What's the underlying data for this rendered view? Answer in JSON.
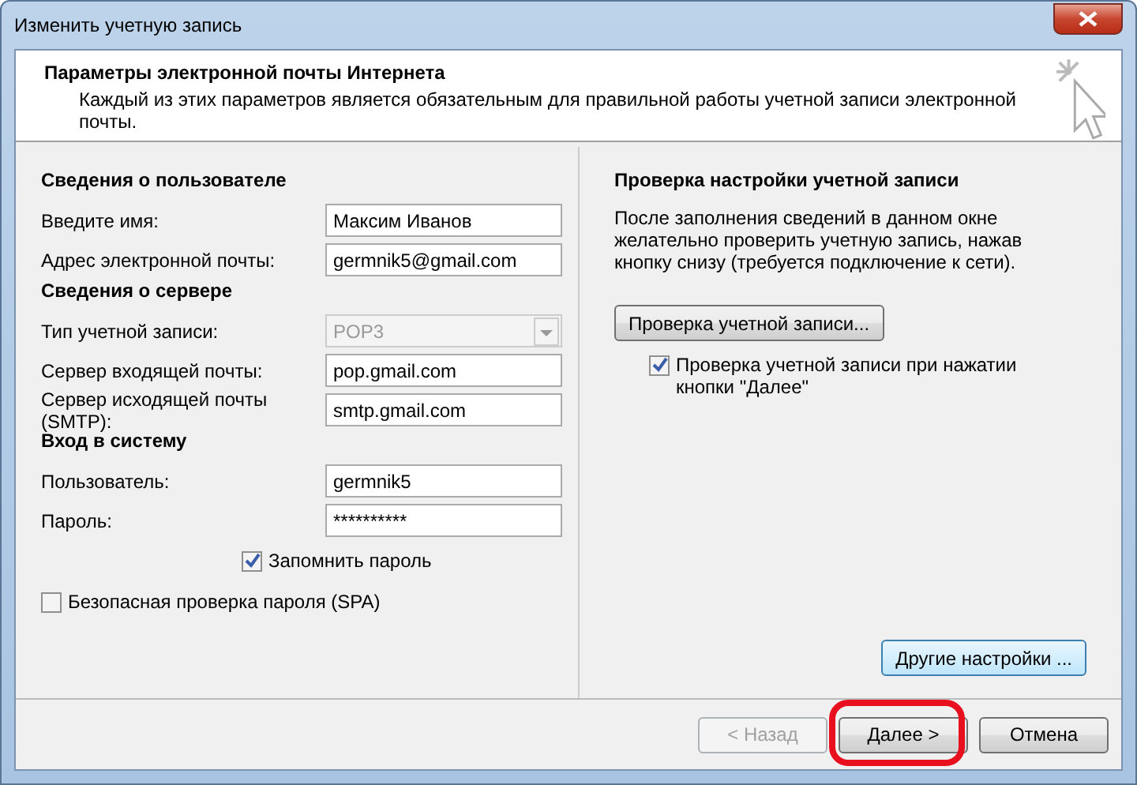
{
  "window": {
    "title": "Изменить учетную запись"
  },
  "header": {
    "title": "Параметры электронной почты Интернета",
    "subtitle": "Каждый из этих параметров является обязательным для правильной работы учетной записи электронной почты."
  },
  "left_sections": [
    {
      "heading": "Сведения о пользователе",
      "fields": [
        {
          "label": "Введите имя:",
          "value": "Максим Иванов",
          "kind": "text",
          "disabled": false
        },
        {
          "label": "Адрес электронной почты:",
          "value": "germnik5@gmail.com",
          "kind": "text",
          "disabled": false
        }
      ]
    },
    {
      "heading": "Сведения о сервере",
      "fields": [
        {
          "label": "Тип учетной записи:",
          "value": "POP3",
          "kind": "dropdown",
          "disabled": true
        },
        {
          "label": "Сервер входящей почты:",
          "value": "pop.gmail.com",
          "kind": "text",
          "disabled": false
        },
        {
          "label": "Сервер исходящей почты (SMTP):",
          "value": "smtp.gmail.com",
          "kind": "text",
          "disabled": false
        }
      ]
    },
    {
      "heading": "Вход в систему",
      "fields": [
        {
          "label": "Пользователь:",
          "value": "germnik5",
          "kind": "text",
          "disabled": false
        },
        {
          "label": "Пароль:",
          "value": "**********",
          "kind": "text",
          "disabled": false
        }
      ]
    }
  ],
  "remember_password": {
    "label": "Запомнить пароль",
    "checked": true
  },
  "spa": {
    "label": "Безопасная проверка пароля (SPA)",
    "checked": false
  },
  "test_panel": {
    "heading": "Проверка настройки учетной записи",
    "text": "После заполнения сведений в данном окне желательно проверить учетную запись, нажав кнопку снизу (требуется подключение к сети).",
    "button": "Проверка учетной записи...",
    "auto_test": {
      "label": "Проверка учетной записи при нажатии кнопки \"Далее\"",
      "checked": true
    }
  },
  "more_settings_button": "Другие настройки ...",
  "buttons": [
    {
      "label": "< Назад",
      "disabled": true,
      "highlighted": false
    },
    {
      "label": "Далее >",
      "disabled": false,
      "highlighted": true
    },
    {
      "label": "Отмена",
      "disabled": false,
      "highlighted": false
    }
  ]
}
